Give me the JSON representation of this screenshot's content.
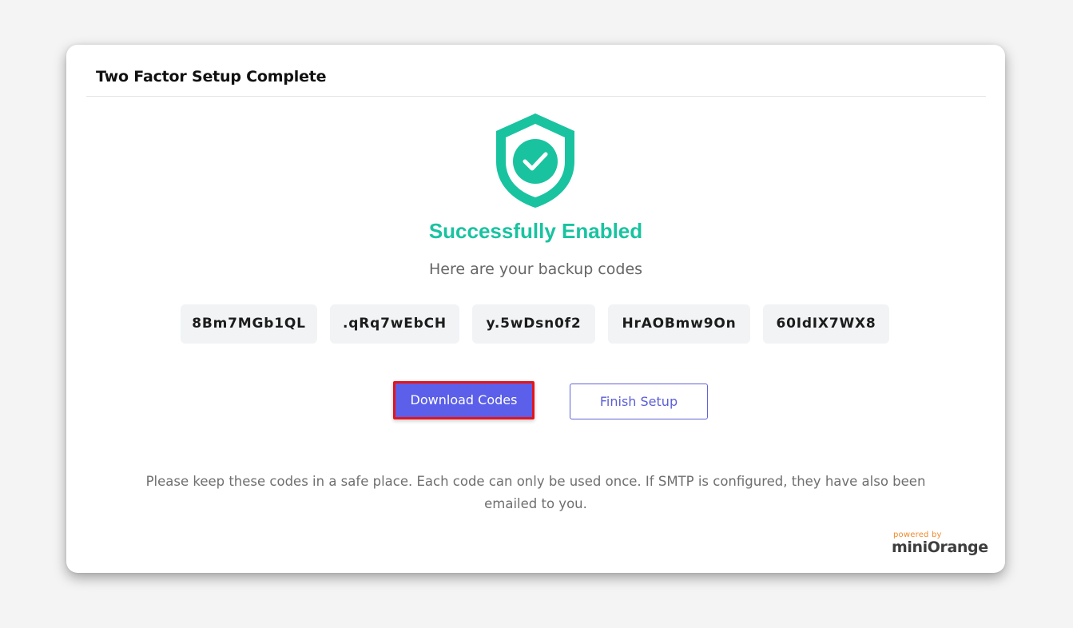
{
  "dialog": {
    "title": "Two Factor Setup Complete",
    "status": "Successfully Enabled",
    "subtitle": "Here are your backup codes",
    "backup_codes": [
      "8Bm7MGb1QL",
      ".qRq7wEbCH",
      "y.5wDsn0f2",
      "HrAOBmw9On",
      "60IdIX7WX8"
    ],
    "buttons": {
      "download_label": "Download Codes",
      "finish_label": "Finish Setup"
    },
    "note": "Please keep these codes in a safe place. Each code can only be used once. If SMTP is configured, they have also been emailed to you."
  },
  "branding": {
    "powered_by": "powered by",
    "name": "miniOrange"
  },
  "icons": {
    "status_icon": "shield-check-icon"
  },
  "colors": {
    "accent_green": "#19c3a0",
    "primary_button": "#5b5fe9",
    "highlight_border": "#e5141a",
    "brand_orange": "#f08a2c"
  }
}
